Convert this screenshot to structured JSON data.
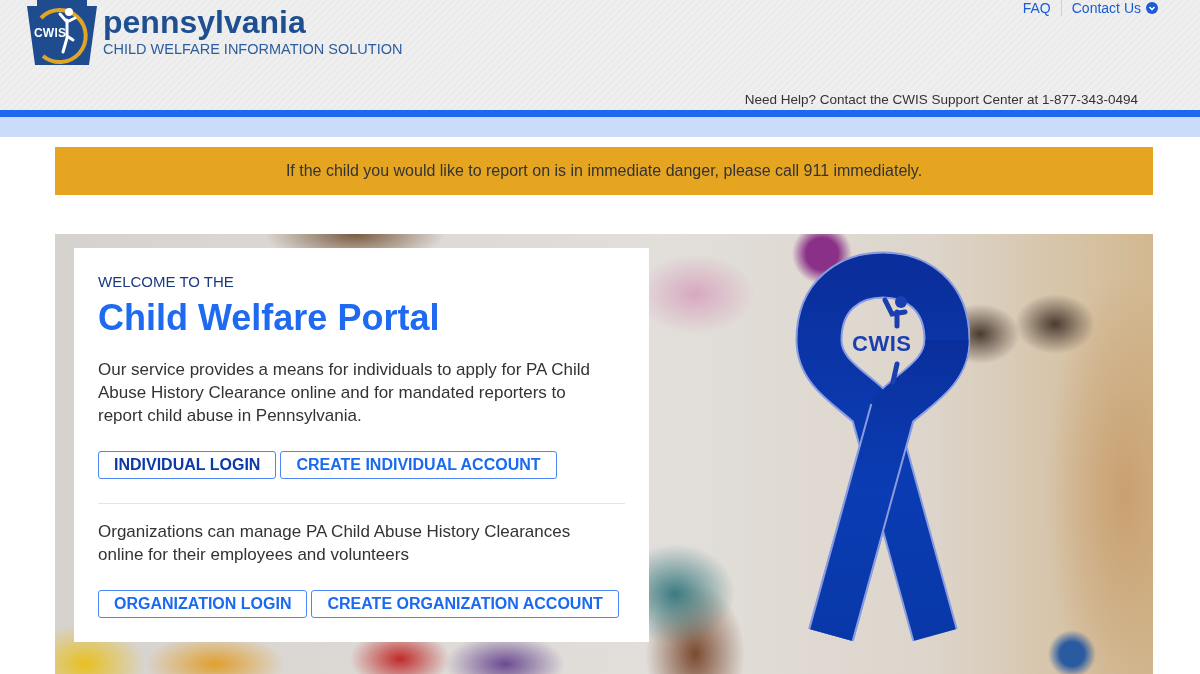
{
  "header": {
    "logo": {
      "mark_text": "CWIS",
      "title": "pennsylvania",
      "subtitle": "CHILD WELFARE INFORMATION SOLUTION"
    },
    "links": [
      {
        "label": "FAQ",
        "kind": "plain"
      },
      {
        "label": "Contact Us",
        "kind": "menu"
      }
    ],
    "help_text": "Need Help? Contact the CWIS Support Center at 1-877-343-0494"
  },
  "alert": {
    "text": "If the child you would like to report on is in immediate danger, please call 911 immediately."
  },
  "hero": {
    "eyebrow": "WELCOME TO THE",
    "title": "Child Welfare Portal",
    "sections": [
      {
        "text": "Our service provides a means for individuals to apply for PA Child Abuse History Clearance online and for mandated reporters to report child abuse in Pennsylvania.",
        "buttons": [
          {
            "label": "INDIVIDUAL LOGIN",
            "focused": true
          },
          {
            "label": "CREATE INDIVIDUAL ACCOUNT",
            "focused": false
          }
        ]
      },
      {
        "text": "Organizations can manage PA Child Abuse History Clearances online for their employees and volunteers",
        "buttons": [
          {
            "label": "ORGANIZATION LOGIN",
            "focused": false
          },
          {
            "label": "CREATE ORGANIZATION ACCOUNT",
            "focused": false
          }
        ]
      }
    ],
    "ribbon_text": "CWIS"
  }
}
